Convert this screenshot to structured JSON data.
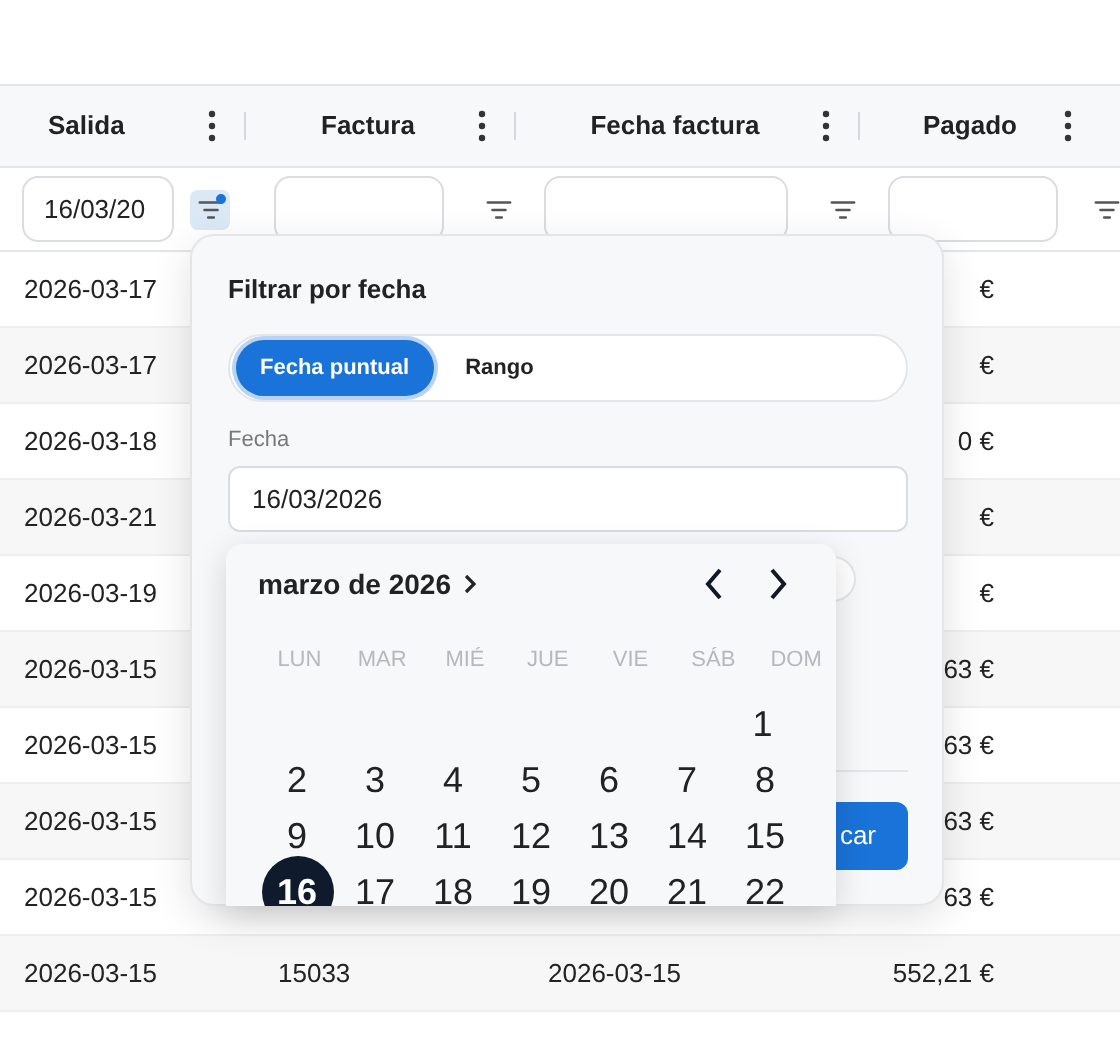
{
  "table": {
    "columns": [
      {
        "label": "Salida"
      },
      {
        "label": "Factura"
      },
      {
        "label": "Fecha factura"
      },
      {
        "label": "Pagado"
      }
    ],
    "filters": [
      {
        "value": "16/03/20",
        "active": true
      },
      {
        "active": false
      },
      {
        "active": false
      },
      {
        "active": false
      }
    ],
    "rows": [
      {
        "salida": "2026-03-17",
        "pagado": "€"
      },
      {
        "salida": "2026-03-17",
        "pagado": "€"
      },
      {
        "salida": "2026-03-18",
        "pagado": "0 €"
      },
      {
        "salida": "2026-03-21",
        "pagado": "€"
      },
      {
        "salida": "2026-03-19",
        "pagado": "€"
      },
      {
        "salida": "2026-03-15",
        "pagado": "63 €"
      },
      {
        "salida": "2026-03-15",
        "pagado": "63 €"
      },
      {
        "salida": "2026-03-15",
        "pagado": "63 €"
      },
      {
        "salida": "2026-03-15",
        "pagado": "63 €"
      },
      {
        "salida": "2026-03-15",
        "factura": "15033",
        "fecha_factura": "2026-03-15",
        "pagado": "552,21 €"
      }
    ]
  },
  "filter_popover": {
    "title": "Filtrar por fecha",
    "modes": [
      {
        "label": "Fecha puntual",
        "selected": true
      },
      {
        "label": "Rango",
        "selected": false
      }
    ],
    "field": {
      "label": "Fecha",
      "value": "16/03/2026"
    },
    "apply_button": "car",
    "calendar": {
      "month_label": "marzo de 2026",
      "weekdays": [
        "LUN",
        "MAR",
        "MIÉ",
        "JUE",
        "VIE",
        "SÁB",
        "DOM"
      ],
      "weeks": [
        {
          "starts_mid_week": true,
          "days": [
            {
              "label": "1",
              "selected": false
            }
          ]
        },
        {
          "days": [
            {
              "label": "2",
              "selected": false
            },
            {
              "label": "3",
              "selected": false
            },
            {
              "label": "4",
              "selected": false
            },
            {
              "label": "5",
              "selected": false
            },
            {
              "label": "6",
              "selected": false
            },
            {
              "label": "7",
              "selected": false
            },
            {
              "label": "8",
              "selected": false
            }
          ]
        },
        {
          "days": [
            {
              "label": "9",
              "selected": false
            },
            {
              "label": "10",
              "selected": false
            },
            {
              "label": "11",
              "selected": false
            },
            {
              "label": "12",
              "selected": false
            },
            {
              "label": "13",
              "selected": false
            },
            {
              "label": "14",
              "selected": false
            },
            {
              "label": "15",
              "selected": false
            }
          ]
        },
        {
          "days": [
            {
              "label": "16",
              "selected": true
            },
            {
              "label": "17",
              "selected": false
            },
            {
              "label": "18",
              "selected": false
            },
            {
              "label": "19",
              "selected": false
            },
            {
              "label": "20",
              "selected": false
            },
            {
              "label": "21",
              "selected": false
            },
            {
              "label": "22",
              "selected": false
            }
          ]
        }
      ]
    }
  }
}
